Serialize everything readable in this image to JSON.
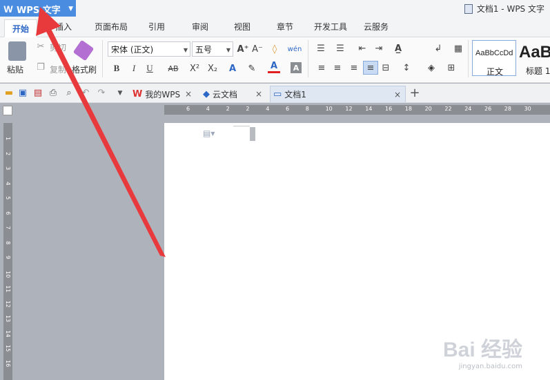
{
  "app": {
    "name": "WPS 文字",
    "logo": "W"
  },
  "window_title": "文档1 - WPS 文字",
  "ribbon_tabs": [
    "开始",
    "插入",
    "页面布局",
    "引用",
    "审阅",
    "视图",
    "章节",
    "开发工具",
    "云服务"
  ],
  "clipboard": {
    "paste": "粘贴",
    "cut": "剪切",
    "copy": "复制",
    "format_painter": "格式刷"
  },
  "font": {
    "family": "宋体 (正文)",
    "size": "五号"
  },
  "format_buttons": {
    "bold": "B",
    "italic": "I",
    "underline": "U",
    "strike": "AB",
    "superscript": "X²",
    "subscript": "X₂",
    "font_color": "A",
    "char_shading": "A"
  },
  "styles": [
    {
      "preview": "AaBbCcDd",
      "name": "正文"
    },
    {
      "preview": "AaB",
      "name": "标题 1"
    }
  ],
  "doc_tabs": [
    {
      "label": "我的WPS"
    },
    {
      "label": "云文档"
    },
    {
      "label": "文档1"
    }
  ],
  "ruler_h": [
    "6",
    "4",
    "2",
    "2",
    "4",
    "6",
    "8",
    "10",
    "12",
    "14",
    "16",
    "18",
    "20",
    "22",
    "24",
    "26",
    "28",
    "30"
  ],
  "ruler_v": [
    "1",
    "2",
    "3",
    "4",
    "5",
    "6",
    "7",
    "8",
    "9",
    "10",
    "11",
    "12",
    "13",
    "14",
    "15",
    "16"
  ],
  "watermark": {
    "brand": "Bai 经验",
    "url": "jingyan.baidu.com"
  },
  "colors": {
    "accent": "#4a8de0",
    "arrow": "#e8393c",
    "font_color_bar": "#e02020"
  }
}
